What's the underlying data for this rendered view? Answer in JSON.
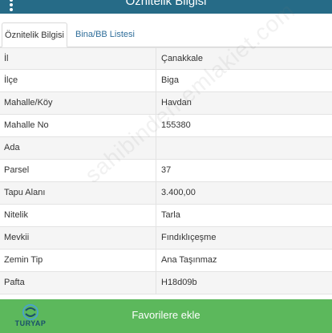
{
  "header": {
    "title": "Öznitelik Bilgisi"
  },
  "tabs": [
    {
      "label": "Öznitelik Bilgisi",
      "active": true
    },
    {
      "label": "Bina/BB Listesi",
      "active": false
    }
  ],
  "attributes": [
    {
      "key": "İl",
      "value": "Çanakkale"
    },
    {
      "key": "İlçe",
      "value": "Biga"
    },
    {
      "key": "Mahalle/Köy",
      "value": "Havdan"
    },
    {
      "key": "Mahalle No",
      "value": "155380"
    },
    {
      "key": "Ada",
      "value": ""
    },
    {
      "key": "Parsel",
      "value": "37"
    },
    {
      "key": "Tapu Alanı",
      "value": "3.400,00"
    },
    {
      "key": "Nitelik",
      "value": "Tarla"
    },
    {
      "key": "Mevkii",
      "value": "Fındıklıçeşme"
    },
    {
      "key": "Zemin Tip",
      "value": "Ana Taşınmaz"
    },
    {
      "key": "Pafta",
      "value": "H18d09b"
    }
  ],
  "watermark": "sahibinden emlakiet.com",
  "footer": {
    "button_label": "Favorilere ekle",
    "logo_text": "TURYAP"
  },
  "colors": {
    "header_bg": "#266b87",
    "footer_bg": "#5cb85c",
    "tab_link": "#2f6e9a"
  }
}
